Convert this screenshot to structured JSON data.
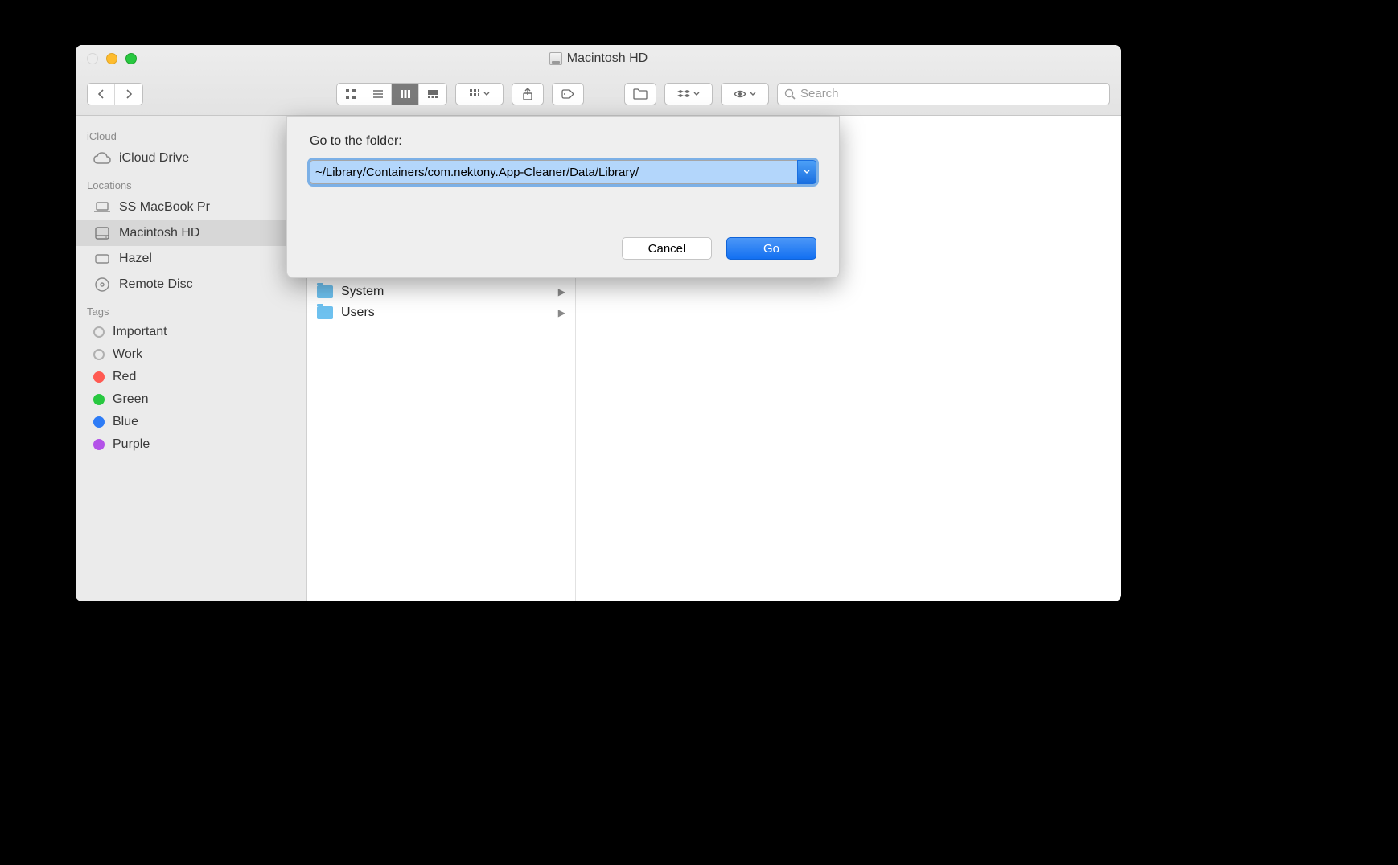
{
  "window": {
    "title": "Macintosh HD"
  },
  "toolbar": {
    "search_placeholder": "Search"
  },
  "sidebar": {
    "sections": {
      "icloud": {
        "heading": "iCloud",
        "items": [
          {
            "label": "iCloud Drive"
          }
        ]
      },
      "locations": {
        "heading": "Locations",
        "items": [
          {
            "label": "SS MacBook Pr"
          },
          {
            "label": "Macintosh HD",
            "selected": true
          },
          {
            "label": "Hazel",
            "ejectable": true
          },
          {
            "label": "Remote Disc"
          }
        ]
      },
      "tags": {
        "heading": "Tags",
        "items": [
          {
            "label": "Important",
            "color": ""
          },
          {
            "label": "Work",
            "color": ""
          },
          {
            "label": "Red",
            "color": "#ff5a52"
          },
          {
            "label": "Green",
            "color": "#28c840"
          },
          {
            "label": "Blue",
            "color": "#2e7cf6"
          },
          {
            "label": "Purple",
            "color": "#b352e8"
          }
        ]
      }
    }
  },
  "column": {
    "items": [
      {
        "label": "System"
      },
      {
        "label": "Users"
      }
    ]
  },
  "dialog": {
    "label": "Go to the folder:",
    "path": "~/Library/Containers/com.nektony.App-Cleaner/Data/Library/",
    "cancel": "Cancel",
    "go": "Go"
  }
}
